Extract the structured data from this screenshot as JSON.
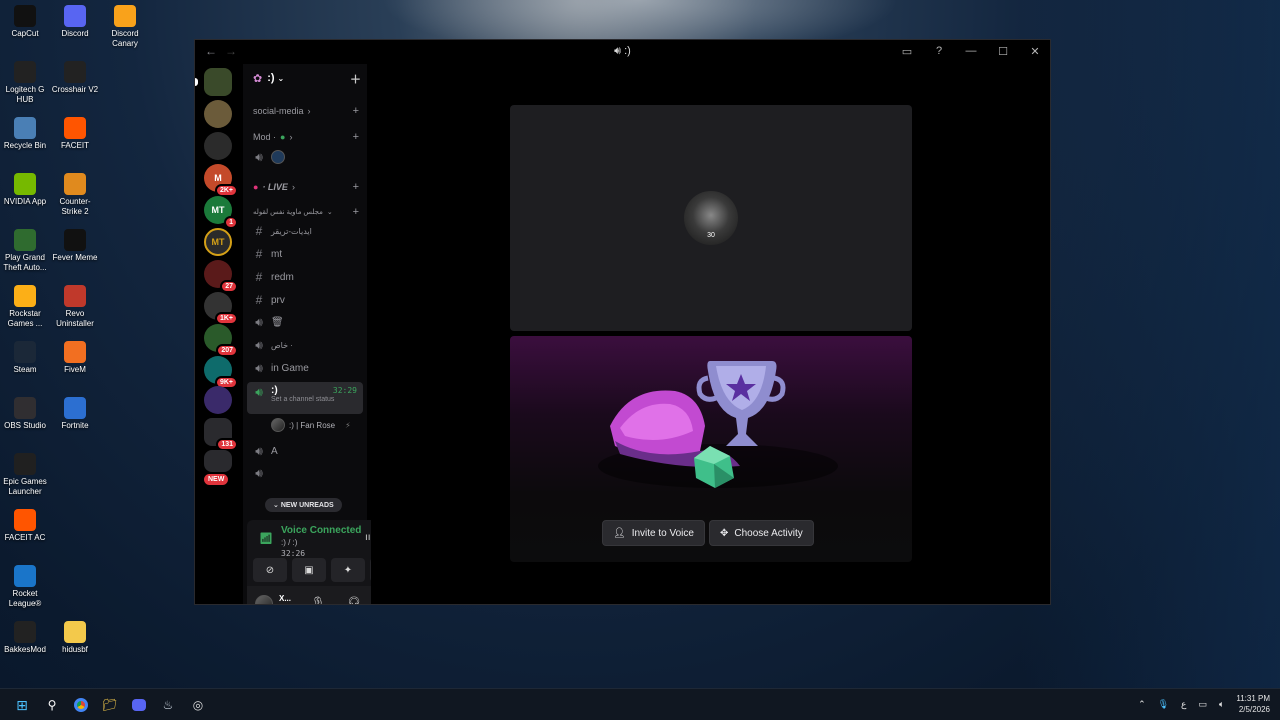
{
  "desktop": {
    "icons": [
      {
        "label": "CapCut",
        "icon": "capcut-icon",
        "color": "#111111"
      },
      {
        "label": "Discord",
        "icon": "discord-icon",
        "color": "#5865f2"
      },
      {
        "label": "Discord Canary",
        "icon": "discord-canary-icon",
        "color": "#f9a21b"
      },
      {
        "label": "Logitech G HUB",
        "icon": "logitech-icon",
        "color": "#222222"
      },
      {
        "label": "Crosshair V2",
        "icon": "crosshair-icon",
        "color": "#222222"
      },
      {
        "label": "Recycle Bin",
        "icon": "recycle-bin-icon",
        "color": "#4a7fb5"
      },
      {
        "label": "FACEIT",
        "icon": "faceit-icon",
        "color": "#ff5500"
      },
      {
        "label": "NVIDIA App",
        "icon": "nvidia-icon",
        "color": "#76b900"
      },
      {
        "label": "Counter-Strike 2",
        "icon": "cs2-icon",
        "color": "#e08a1e"
      },
      {
        "label": "Play Grand Theft Auto...",
        "icon": "gta-icon",
        "color": "#2f6b2f"
      },
      {
        "label": "Fever Meme",
        "icon": "fever-meme-icon",
        "color": "#111111"
      },
      {
        "label": "Rockstar Games ...",
        "icon": "rockstar-icon",
        "color": "#fcaf17"
      },
      {
        "label": "Revo Uninstaller",
        "icon": "revo-icon",
        "color": "#c0392b"
      },
      {
        "label": "Steam",
        "icon": "steam-icon",
        "color": "#1b2838"
      },
      {
        "label": "OBS Studio",
        "icon": "obs-icon",
        "color": "#302e31"
      },
      {
        "label": "FiveM",
        "icon": "fivem-icon",
        "color": "#f26f21"
      },
      {
        "label": "Epic Games Launcher",
        "icon": "epic-icon",
        "color": "#202020"
      },
      {
        "label": "Fortnite",
        "icon": "fortnite-icon",
        "color": "#2c6fd1"
      },
      {
        "label": "FACEIT AC",
        "icon": "faceit-ac-icon",
        "color": "#ff5500"
      },
      {
        "label": "Rocket League®",
        "icon": "rocket-league-icon",
        "color": "#1a75c9"
      },
      {
        "label": "BakkesMod",
        "icon": "bakkesmod-icon",
        "color": "#222222"
      },
      {
        "label": "hidusbf",
        "icon": "folder-icon",
        "color": "#f3c94b"
      }
    ]
  },
  "window": {
    "title": ":)",
    "nav_back": "←",
    "nav_forward": "→"
  },
  "server_rail": {
    "badges": [
      "2K+",
      "1",
      "27",
      "1K+",
      "207",
      "9K+",
      "131"
    ],
    "new_label": "NEW"
  },
  "channels": {
    "server_name": ":)",
    "categories": [
      "social-media",
      "Mod ·",
      "· LIVE",
      "مجلس ماوية نفس لقوله"
    ],
    "text_channels": [
      "ايديات-تريقر",
      "mt",
      "redm",
      "prv"
    ],
    "voice_channels": [
      "🗑",
      "خاص ·",
      "in Game"
    ],
    "active_channel": {
      "name": ":)",
      "status": "Set a channel status",
      "timer": "32:29"
    },
    "member": ":) | Fan Rose",
    "after_active": "A",
    "new_unreads": "NEW UNREADS"
  },
  "voice_panel": {
    "status": "Voice Connected",
    "channel": ":) / :)",
    "time": "32:26"
  },
  "user_panel": {
    "username": "X..."
  },
  "stage": {
    "avatar_number": "30",
    "buttons": {
      "invite": "Invite to Voice",
      "activity": "Choose Activity"
    }
  },
  "taskbar": {
    "time": "11:31 PM",
    "date": "2/5/2026",
    "lang": "ع"
  }
}
